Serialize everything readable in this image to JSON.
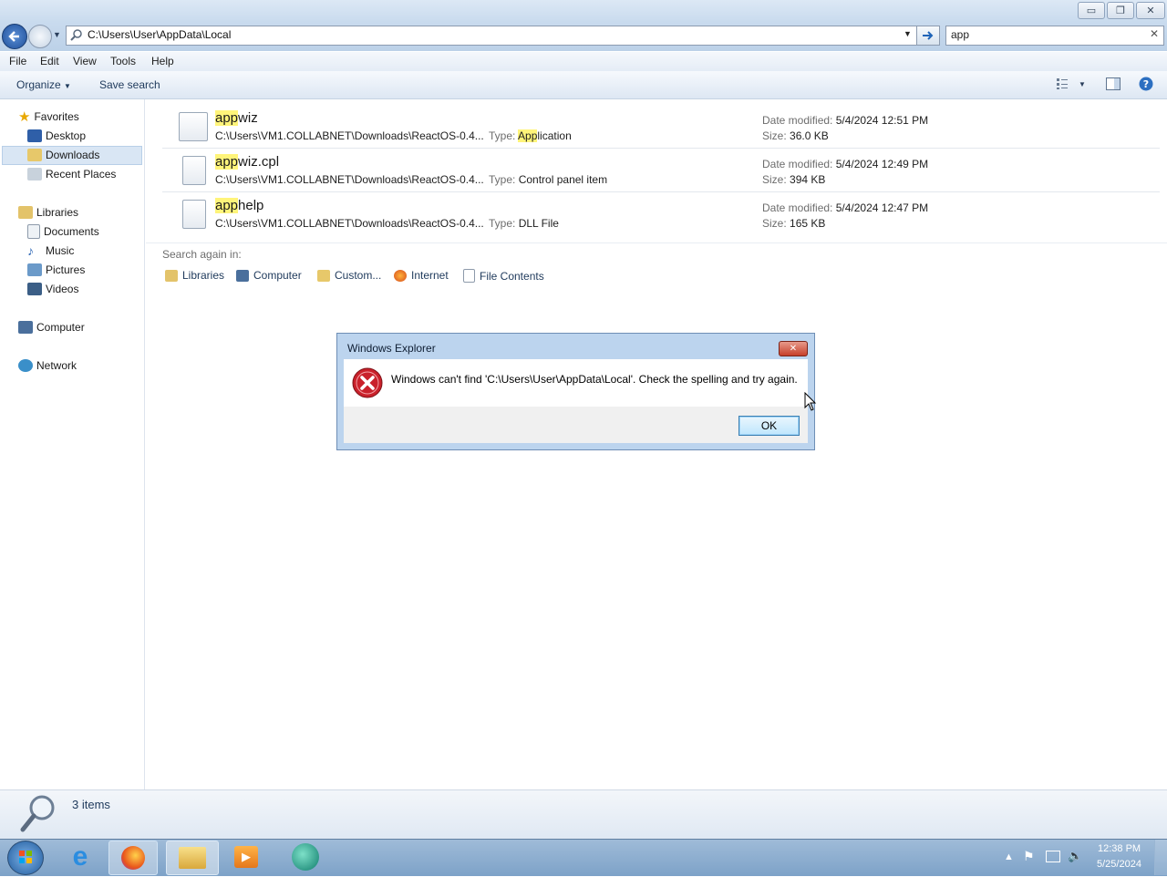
{
  "window": {
    "address": "C:\\Users\\User\\AppData\\Local",
    "search_query": "app"
  },
  "menu": [
    "File",
    "Edit",
    "View",
    "Tools",
    "Help"
  ],
  "command_bar": {
    "organize": "Organize",
    "save_search": "Save search"
  },
  "nav": {
    "favorites": "Favorites",
    "desktop": "Desktop",
    "downloads": "Downloads",
    "recent_places": "Recent Places",
    "libraries": "Libraries",
    "documents": "Documents",
    "music": "Music",
    "pictures": "Pictures",
    "videos": "Videos",
    "computer": "Computer",
    "network": "Network"
  },
  "results": [
    {
      "name_hl": "app",
      "name_rest": "wiz",
      "path": "C:\\Users\\VM1.COLLABNET\\Downloads\\ReactOS-0.4...",
      "type_label": "Type:",
      "type_hl": "App",
      "type_rest": "lication",
      "date_label": "Date modified:",
      "date": "5/4/2024 12:51 PM",
      "size_label": "Size:",
      "size": "36.0 KB"
    },
    {
      "name_hl": "app",
      "name_rest": "wiz.cpl",
      "path": "C:\\Users\\VM1.COLLABNET\\Downloads\\ReactOS-0.4...",
      "type_label": "Type:",
      "type_hl": "",
      "type_rest": "Control panel item",
      "date_label": "Date modified:",
      "date": "5/4/2024 12:49 PM",
      "size_label": "Size:",
      "size": "394 KB"
    },
    {
      "name_hl": "app",
      "name_rest": "help",
      "path": "C:\\Users\\VM1.COLLABNET\\Downloads\\ReactOS-0.4...",
      "type_label": "Type:",
      "type_hl": "",
      "type_rest": "DLL File",
      "date_label": "Date modified:",
      "date": "5/4/2024 12:47 PM",
      "size_label": "Size:",
      "size": "165 KB"
    }
  ],
  "search_again": {
    "label": "Search again in:",
    "libraries": "Libraries",
    "computer": "Computer",
    "custom": "Custom...",
    "internet": "Internet",
    "file_contents": "File Contents"
  },
  "dialog": {
    "title": "Windows Explorer",
    "message": "Windows can't find 'C:\\Users\\User\\AppData\\Local'.  Check the spelling and try again.",
    "ok": "OK"
  },
  "status": {
    "items": "3 items"
  },
  "tray": {
    "time": "12:38 PM",
    "date": "5/25/2024"
  },
  "colors": {
    "highlight": "#fff47a",
    "error_red": "#c9212b",
    "taskbar": "#7da2c8"
  }
}
